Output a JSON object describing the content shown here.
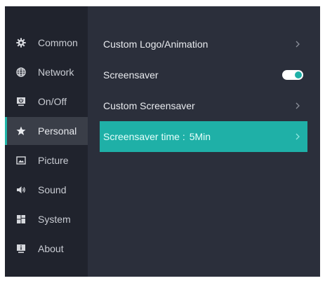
{
  "sidebar": {
    "items": [
      {
        "label": "Common",
        "icon": "gear-icon"
      },
      {
        "label": "Network",
        "icon": "globe-icon"
      },
      {
        "label": "On/Off",
        "icon": "power-monitor-icon"
      },
      {
        "label": "Personal",
        "icon": "star-icon",
        "active": true
      },
      {
        "label": "Picture",
        "icon": "picture-icon"
      },
      {
        "label": "Sound",
        "icon": "speaker-icon"
      },
      {
        "label": "System",
        "icon": "system-grid-icon"
      },
      {
        "label": "About",
        "icon": "info-monitor-icon"
      }
    ]
  },
  "main": {
    "custom_logo": {
      "label": "Custom Logo/Animation"
    },
    "screensaver": {
      "label": "Screensaver",
      "toggle_on": true
    },
    "custom_screensaver": {
      "label": "Custom Screensaver"
    },
    "screensaver_time": {
      "label": "Screensaver time :",
      "value": "5Min"
    }
  },
  "colors": {
    "accent": "#1fb0a7",
    "background": "#2b2f3b",
    "sidebar_background": "#20232d",
    "active_item_background": "#3a3e48"
  }
}
